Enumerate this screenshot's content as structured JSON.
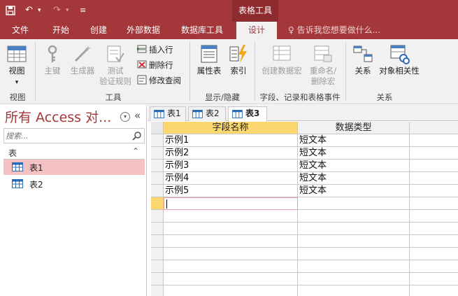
{
  "quick_access": {
    "save_icon": "save-icon",
    "undo_glyph": "↶",
    "undo_dd": "▾",
    "redo_glyph": "↷",
    "redo_dd": "▾",
    "customize_glyph": "≡"
  },
  "context_title": "表格工具",
  "tabs": [
    {
      "label": "文件"
    },
    {
      "label": "开始"
    },
    {
      "label": "创建"
    },
    {
      "label": "外部数据"
    },
    {
      "label": "数据库工具"
    },
    {
      "label": "设计"
    }
  ],
  "tellme": "♀ 告诉我您想要做什么...",
  "ribbon": {
    "view": {
      "label": "视图",
      "dd": "▾",
      "group": "视图"
    },
    "tools": {
      "primary_key": "主键",
      "builder": "生成器",
      "test_rules": [
        "测试",
        "验证规则"
      ],
      "insert_rows": "插入行",
      "delete_rows": "删除行",
      "modify_lookups": "修改查阅",
      "group": "工具"
    },
    "show_hide": {
      "property_sheet": "属性表",
      "indexes": "索引",
      "group": "显示/隐藏"
    },
    "field_events": {
      "create_macro": "创建数据宏",
      "rename_delete": [
        "重命名/",
        "删除宏"
      ],
      "group": "字段、记录和表格事件"
    },
    "relationships": {
      "relationships": "关系",
      "object_dependencies": "对象相关性",
      "group": "关系"
    }
  },
  "nav": {
    "title": "所有 Access 对...",
    "dropdown_glyph": "▾",
    "collapse_glyph": "«",
    "search_placeholder": "搜索...",
    "group_label": "表",
    "group_toggle": "⌃",
    "items": [
      {
        "label": "表1",
        "selected": true
      },
      {
        "label": "表2",
        "selected": false
      }
    ]
  },
  "doc_tabs": [
    {
      "label": "表1",
      "active": false
    },
    {
      "label": "表2",
      "active": false
    },
    {
      "label": "表3",
      "active": true
    }
  ],
  "grid": {
    "headers": [
      "字段名称",
      "数据类型"
    ],
    "rows": [
      [
        "示例1",
        "短文本"
      ],
      [
        "示例2",
        "短文本"
      ],
      [
        "示例3",
        "短文本"
      ],
      [
        "示例4",
        "短文本"
      ],
      [
        "示例5",
        "短文本"
      ]
    ]
  },
  "colors": {
    "accent": "#a4373a",
    "ribbon_bg": "#f1f1f1",
    "selection": "#f5c2c4",
    "active_header": "#fcd770"
  }
}
